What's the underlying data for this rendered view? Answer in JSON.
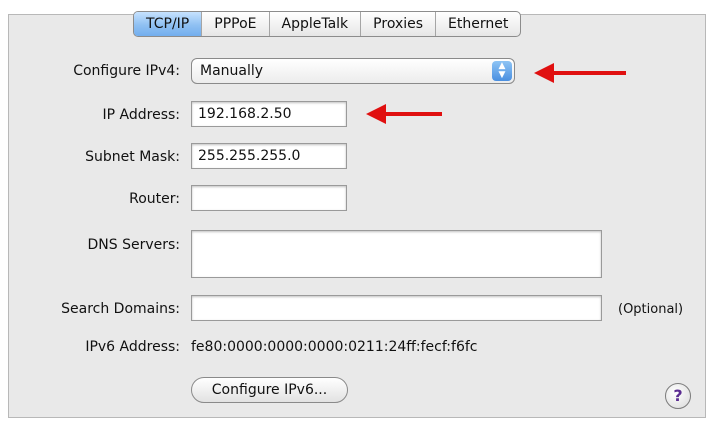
{
  "tabs": [
    "TCP/IP",
    "PPPoE",
    "AppleTalk",
    "Proxies",
    "Ethernet"
  ],
  "active_tab": "TCP/IP",
  "form": {
    "configure_ipv4_label": "Configure IPv4:",
    "configure_ipv4_value": "Manually",
    "ip_address_label": "IP Address:",
    "ip_address_value": "192.168.2.50",
    "subnet_mask_label": "Subnet Mask:",
    "subnet_mask_value": "255.255.255.0",
    "router_label": "Router:",
    "router_value": "",
    "dns_servers_label": "DNS Servers:",
    "dns_servers_value": "",
    "search_domains_label": "Search Domains:",
    "search_domains_value": "",
    "optional_hint": "(Optional)",
    "ipv6_address_label": "IPv6 Address:",
    "ipv6_address_value": "fe80:0000:0000:0000:0211:24ff:fecf:f6fc"
  },
  "buttons": {
    "configure_ipv6": "Configure IPv6...",
    "help": "?"
  },
  "colors": {
    "annotation_arrow": "#e01010",
    "active_tab": "#8fc0f2",
    "panel_background": "#e9e9e9"
  }
}
